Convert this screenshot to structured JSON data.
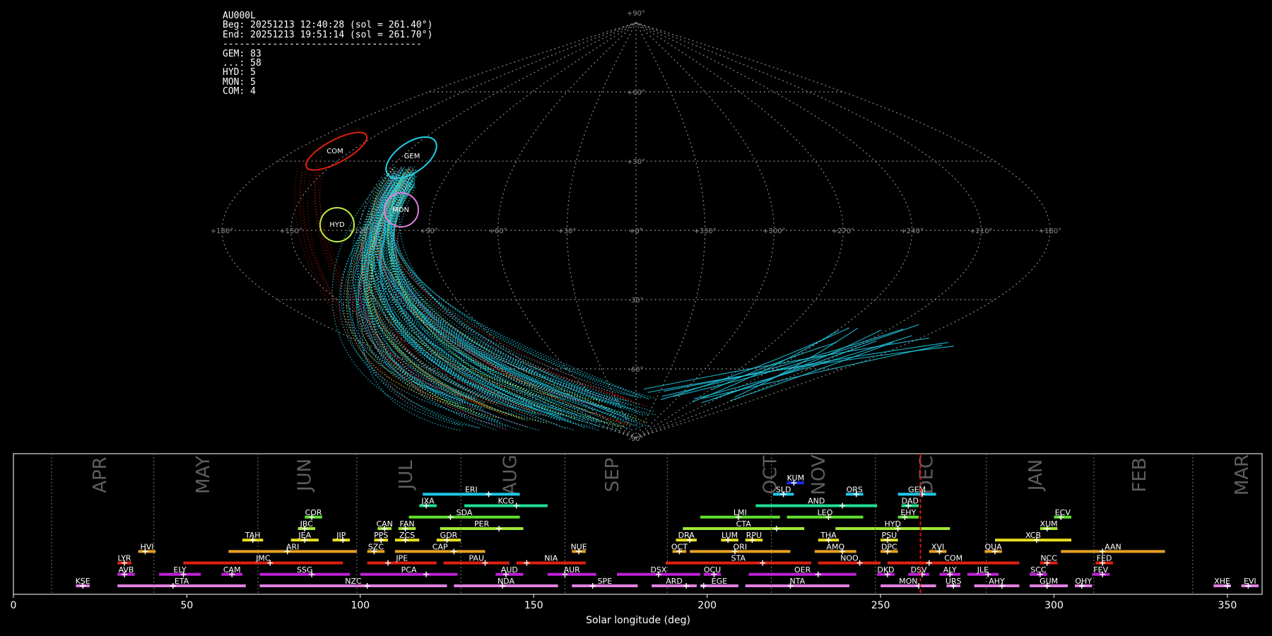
{
  "info": {
    "station": "AU000L",
    "beg": "Beg: 20251213 12:40:28 (sol = 261.40°)",
    "end": "End: 20251213 19:51:14 (sol = 261.70°)",
    "separator": "------------------------------------",
    "counts": [
      "GEM: 83",
      "...: 58",
      "HYD: 5",
      "MON: 5",
      "COM: 4"
    ]
  },
  "sky_map": {
    "lat_labels": [
      "+90°",
      "+60°",
      "+30°",
      "+0°",
      "-30°",
      "-60°",
      "-90°"
    ],
    "lon_labels": [
      "+180°",
      "+150°",
      "+120°",
      "+90°",
      "+60°",
      "+30°",
      "+0°",
      "+330°",
      "+300°",
      "+270°",
      "+240°",
      "+210°",
      "+180°"
    ],
    "radiants": [
      {
        "name": "COM",
        "color": "#e02010"
      },
      {
        "name": "GEM",
        "color": "#20d0e8"
      },
      {
        "name": "HYD",
        "color": "#c0f040"
      },
      {
        "name": "MON",
        "color": "#e080e0"
      }
    ]
  },
  "chart_data": {
    "type": "timeline",
    "xlabel": "Solar longitude (deg)",
    "xlim": [
      0,
      360
    ],
    "xticks": [
      0,
      50,
      100,
      150,
      200,
      250,
      300,
      350
    ],
    "current_sol": 261.5,
    "months": [
      {
        "name": "APR",
        "start": 11,
        "end": 40.5
      },
      {
        "name": "MAY",
        "start": 40.5,
        "end": 70.5
      },
      {
        "name": "JUN",
        "start": 70.5,
        "end": 99
      },
      {
        "name": "JUL",
        "start": 99,
        "end": 129
      },
      {
        "name": "AUG",
        "start": 129,
        "end": 159
      },
      {
        "name": "SEP",
        "start": 159,
        "end": 188
      },
      {
        "name": "OCT",
        "start": 188,
        "end": 250
      },
      {
        "name": "NOV",
        "start": 218,
        "end": 248
      },
      {
        "name": "DEC",
        "start": 248,
        "end": 280
      },
      {
        "name": "JAN",
        "start": 280,
        "end": 311
      },
      {
        "name": "FEB",
        "start": 311,
        "end": 340
      },
      {
        "name": "MAR",
        "start": 340,
        "end": 370
      }
    ],
    "month_boundaries": [
      11,
      40.5,
      70.5,
      99,
      129,
      159,
      188.5,
      218.5,
      248.5,
      280.5,
      311.5,
      340
    ],
    "showers": [
      {
        "code": "KUM",
        "start": 223,
        "end": 228,
        "peak": 225,
        "row": 11,
        "color": "#1d2be0"
      },
      {
        "code": "ERI",
        "start": 118,
        "end": 146,
        "peak": 137,
        "row": 10,
        "color": "#1ec8e8"
      },
      {
        "code": "SLD",
        "start": 219,
        "end": 225,
        "peak": 222,
        "row": 10,
        "color": "#1ec8e8"
      },
      {
        "code": "ORS",
        "start": 240,
        "end": 245,
        "peak": 243,
        "row": 10,
        "color": "#1ec8e8"
      },
      {
        "code": "GEM",
        "start": 255,
        "end": 266,
        "peak": 262,
        "row": 10,
        "color": "#1ec8e8"
      },
      {
        "code": "JXA",
        "start": 117,
        "end": 122,
        "peak": 119,
        "row": 9,
        "color": "#20e090"
      },
      {
        "code": "KCG",
        "start": 130,
        "end": 154,
        "peak": 145,
        "row": 9,
        "color": "#20e090"
      },
      {
        "code": "AND",
        "start": 214,
        "end": 249,
        "peak": 239,
        "row": 9,
        "color": "#20e090"
      },
      {
        "code": "DAD",
        "start": 256,
        "end": 261,
        "peak": 258,
        "row": 9,
        "color": "#20e090"
      },
      {
        "code": "COR",
        "start": 84,
        "end": 89,
        "peak": 86,
        "row": 8,
        "color": "#60e030"
      },
      {
        "code": "SDA",
        "start": 114,
        "end": 146,
        "peak": 126,
        "row": 8,
        "color": "#60e030"
      },
      {
        "code": "LMI",
        "start": 198,
        "end": 221,
        "peak": 209,
        "row": 8,
        "color": "#60e030"
      },
      {
        "code": "LEO",
        "start": 223,
        "end": 245,
        "peak": 235,
        "row": 8,
        "color": "#60e030"
      },
      {
        "code": "EHY",
        "start": 255,
        "end": 261,
        "peak": 257,
        "row": 8,
        "color": "#60e030"
      },
      {
        "code": "ECV",
        "start": 300,
        "end": 305,
        "peak": 302,
        "row": 8,
        "color": "#60e030"
      },
      {
        "code": "JBC",
        "start": 82,
        "end": 87,
        "peak": 84,
        "row": 7,
        "color": "#a0e838"
      },
      {
        "code": "CAN",
        "start": 105,
        "end": 109,
        "peak": 107,
        "row": 7,
        "color": "#a0e838"
      },
      {
        "code": "FAN",
        "start": 111,
        "end": 116,
        "peak": 113,
        "row": 7,
        "color": "#a0e838"
      },
      {
        "code": "PER",
        "start": 123,
        "end": 147,
        "peak": 140,
        "row": 7,
        "color": "#a0e838"
      },
      {
        "code": "CTA",
        "start": 193,
        "end": 228,
        "peak": 220,
        "row": 7,
        "color": "#a0e838"
      },
      {
        "code": "HYD",
        "start": 237,
        "end": 270,
        "peak": 255,
        "row": 7,
        "color": "#a0e838"
      },
      {
        "code": "XUM",
        "start": 296,
        "end": 301,
        "peak": 298,
        "row": 7,
        "color": "#a0e838"
      },
      {
        "code": "TAH",
        "start": 66,
        "end": 72,
        "peak": 69,
        "row": 6,
        "color": "#e8e020"
      },
      {
        "code": "JEA",
        "start": 80,
        "end": 88,
        "peak": 84,
        "row": 6,
        "color": "#e8e020"
      },
      {
        "code": "JIP",
        "start": 92,
        "end": 97,
        "peak": 95,
        "row": 6,
        "color": "#e8e020"
      },
      {
        "code": "PPS",
        "start": 104,
        "end": 108,
        "peak": 106,
        "row": 6,
        "color": "#e8e020"
      },
      {
        "code": "ZCS",
        "start": 110,
        "end": 117,
        "peak": 113,
        "row": 6,
        "color": "#e8e020"
      },
      {
        "code": "GDR",
        "start": 122,
        "end": 129,
        "peak": 125,
        "row": 6,
        "color": "#e8e020"
      },
      {
        "code": "DRA",
        "start": 191,
        "end": 197,
        "peak": 195,
        "row": 6,
        "color": "#e8e020"
      },
      {
        "code": "LUM",
        "start": 204,
        "end": 209,
        "peak": 206,
        "row": 6,
        "color": "#e8e020"
      },
      {
        "code": "RPU",
        "start": 211,
        "end": 216,
        "peak": 213,
        "row": 6,
        "color": "#e8e020"
      },
      {
        "code": "THA",
        "start": 232,
        "end": 238,
        "peak": 235,
        "row": 6,
        "color": "#e8e020"
      },
      {
        "code": "PSU",
        "start": 250,
        "end": 255,
        "peak": 252,
        "row": 6,
        "color": "#e8e020"
      },
      {
        "code": "XCB",
        "start": 283,
        "end": 305,
        "peak": 295,
        "row": 6,
        "color": "#e8e020"
      },
      {
        "code": "HVI",
        "start": 36,
        "end": 41,
        "peak": 38,
        "row": 5,
        "color": "#e8a020"
      },
      {
        "code": "ARI",
        "start": 62,
        "end": 99,
        "peak": 79,
        "row": 5,
        "color": "#e8a020"
      },
      {
        "code": "SZC",
        "start": 102,
        "end": 107,
        "peak": 104,
        "row": 5,
        "color": "#e8a020"
      },
      {
        "code": "CAP",
        "start": 110,
        "end": 136,
        "peak": 127,
        "row": 5,
        "color": "#e8a020"
      },
      {
        "code": "NUE",
        "start": 161,
        "end": 165,
        "peak": 163,
        "row": 5,
        "color": "#e8a020"
      },
      {
        "code": "OCT",
        "start": 190,
        "end": 194,
        "peak": 192,
        "row": 5,
        "color": "#e8a020"
      },
      {
        "code": "ORI",
        "start": 195,
        "end": 224,
        "peak": 208,
        "row": 5,
        "color": "#e8a020"
      },
      {
        "code": "AMO",
        "start": 231,
        "end": 243,
        "peak": 239,
        "row": 5,
        "color": "#e8a020"
      },
      {
        "code": "DPC",
        "start": 250,
        "end": 255,
        "peak": 252,
        "row": 5,
        "color": "#e8a020"
      },
      {
        "code": "XVI",
        "start": 264,
        "end": 269,
        "peak": 267,
        "row": 5,
        "color": "#e8a020"
      },
      {
        "code": "QUA",
        "start": 280,
        "end": 285,
        "peak": 283,
        "row": 5,
        "color": "#e8a020"
      },
      {
        "code": "AAN",
        "start": 302,
        "end": 332,
        "peak": 314,
        "row": 5,
        "color": "#e8a020"
      },
      {
        "code": "LYR",
        "start": 30,
        "end": 34,
        "peak": 32,
        "row": 4,
        "color": "#e02010"
      },
      {
        "code": "JMC",
        "start": 49,
        "end": 95,
        "peak": 74,
        "row": 4,
        "color": "#e02010"
      },
      {
        "code": "JPE",
        "start": 102,
        "end": 122,
        "peak": 108,
        "row": 4,
        "color": "#e02010"
      },
      {
        "code": "PAU",
        "start": 124,
        "end": 143,
        "peak": 136,
        "row": 4,
        "color": "#e02010"
      },
      {
        "code": "NIA",
        "start": 145,
        "end": 165,
        "peak": 148,
        "row": 4,
        "color": "#e02010"
      },
      {
        "code": "STA",
        "start": 188,
        "end": 230,
        "peak": 216,
        "row": 4,
        "color": "#e02010"
      },
      {
        "code": "NOO",
        "start": 232,
        "end": 250,
        "peak": 244,
        "row": 4,
        "color": "#e02010"
      },
      {
        "code": "COM",
        "start": 252,
        "end": 290,
        "peak": 264,
        "row": 4,
        "color": "#e02010"
      },
      {
        "code": "NCC",
        "start": 296,
        "end": 301,
        "peak": 298,
        "row": 4,
        "color": "#e02010"
      },
      {
        "code": "FED",
        "start": 312,
        "end": 317,
        "peak": 314,
        "row": 4,
        "color": "#e02010"
      },
      {
        "code": "AVB",
        "start": 30,
        "end": 35,
        "peak": 32,
        "row": 3,
        "color": "#c020d8"
      },
      {
        "code": "ELY",
        "start": 42,
        "end": 54,
        "peak": 49,
        "row": 3,
        "color": "#c020d8"
      },
      {
        "code": "CAM",
        "start": 60,
        "end": 66,
        "peak": 63,
        "row": 3,
        "color": "#c020d8"
      },
      {
        "code": "SSG",
        "start": 71,
        "end": 97,
        "peak": 86,
        "row": 3,
        "color": "#c020d8"
      },
      {
        "code": "PCA",
        "start": 100,
        "end": 128,
        "peak": 119,
        "row": 3,
        "color": "#c020d8"
      },
      {
        "code": "AUD",
        "start": 139,
        "end": 147,
        "peak": 142,
        "row": 3,
        "color": "#c020d8"
      },
      {
        "code": "AUR",
        "start": 154,
        "end": 168,
        "peak": 159,
        "row": 3,
        "color": "#c020d8"
      },
      {
        "code": "DSX",
        "start": 174,
        "end": 198,
        "peak": 186,
        "row": 3,
        "color": "#c020d8"
      },
      {
        "code": "OCU",
        "start": 199,
        "end": 204,
        "peak": 202,
        "row": 3,
        "color": "#c020d8"
      },
      {
        "code": "OER",
        "start": 212,
        "end": 243,
        "peak": 232,
        "row": 3,
        "color": "#c020d8"
      },
      {
        "code": "DKD",
        "start": 249,
        "end": 254,
        "peak": 252,
        "row": 3,
        "color": "#c020d8"
      },
      {
        "code": "DSV",
        "start": 258,
        "end": 264,
        "peak": 262,
        "row": 3,
        "color": "#c020d8"
      },
      {
        "code": "ALY",
        "start": 267,
        "end": 273,
        "peak": 270,
        "row": 3,
        "color": "#c020d8"
      },
      {
        "code": "JLE",
        "start": 275,
        "end": 284,
        "peak": 281,
        "row": 3,
        "color": "#c020d8"
      },
      {
        "code": "SCC",
        "start": 293,
        "end": 298,
        "peak": 296,
        "row": 3,
        "color": "#c020d8"
      },
      {
        "code": "FEV",
        "start": 311,
        "end": 316,
        "peak": 314,
        "row": 3,
        "color": "#c020d8"
      },
      {
        "code": "KSE",
        "start": 18,
        "end": 22,
        "peak": 20,
        "row": 2,
        "color": "#e080e0"
      },
      {
        "code": "ETA",
        "start": 30,
        "end": 67,
        "peak": 46,
        "row": 2,
        "color": "#e080e0"
      },
      {
        "code": "NZC",
        "start": 71,
        "end": 125,
        "peak": 102,
        "row": 2,
        "color": "#e080e0"
      },
      {
        "code": "NDA",
        "start": 127,
        "end": 157,
        "peak": 141,
        "row": 2,
        "color": "#e080e0"
      },
      {
        "code": "SPE",
        "start": 161,
        "end": 180,
        "peak": 167,
        "row": 2,
        "color": "#e080e0"
      },
      {
        "code": "ARD",
        "start": 184,
        "end": 197,
        "peak": 194,
        "row": 2,
        "color": "#e080e0"
      },
      {
        "code": "EGE",
        "start": 198,
        "end": 209,
        "peak": 199,
        "row": 2,
        "color": "#e080e0"
      },
      {
        "code": "NTA",
        "start": 211,
        "end": 241,
        "peak": 224,
        "row": 2,
        "color": "#e080e0"
      },
      {
        "code": "MON",
        "start": 250,
        "end": 266,
        "peak": 261,
        "row": 2,
        "color": "#e080e0"
      },
      {
        "code": "URS",
        "start": 269,
        "end": 273,
        "peak": 271,
        "row": 2,
        "color": "#e080e0"
      },
      {
        "code": "AHY",
        "start": 277,
        "end": 290,
        "peak": 285,
        "row": 2,
        "color": "#e080e0"
      },
      {
        "code": "GUM",
        "start": 293,
        "end": 304,
        "peak": 298,
        "row": 2,
        "color": "#e080e0"
      },
      {
        "code": "OHY",
        "start": 306,
        "end": 311,
        "peak": 308,
        "row": 2,
        "color": "#e080e0"
      },
      {
        "code": "XHE",
        "start": 346,
        "end": 351,
        "peak": 350,
        "row": 2,
        "color": "#e080e0"
      },
      {
        "code": "EVI",
        "start": 354,
        "end": 359,
        "peak": 356,
        "row": 2,
        "color": "#e080e0"
      }
    ]
  }
}
